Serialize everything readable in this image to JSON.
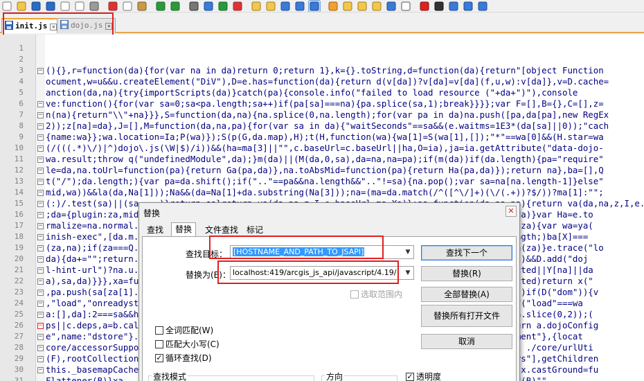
{
  "tabs": [
    {
      "label": "init.js"
    },
    {
      "label": "dojo.js"
    }
  ],
  "line_numbers": [
    "1",
    "2",
    "3",
    "4",
    "5",
    "6",
    "7",
    "8",
    "9",
    "10",
    "11",
    "12",
    "13",
    "14",
    "15",
    "16",
    "17",
    "18",
    "19",
    "20",
    "21",
    "22",
    "23",
    "24",
    "25",
    "26",
    "27",
    "28",
    "29",
    "30",
    "31"
  ],
  "code_lines": [
    "",
    "",
    "(){},r=function(da){for(var na in da)return 0;return 1},k={}.toString,d=function(da){return\"[object Function",
    "ocument,w=u&&u.createElement(\"DiV\"),D=e.has=function(da){return d(v[da])?v[da]=v[da](f,u,w):v[da]},v=D.cache=",
    "anction(da,na){try{importScripts(da)}catch(pa){console.info(\"failed to load resource (\"+da+\")\"),console",
    "ve:function(){for(var sa=0;sa<pa.length;sa++)if(pa[sa]===na){pa.splice(sa,1);break}}}};var F=[],B={},C=[],z=",
    "n(na){return\"\\\\\"+na}}},S=function(da,na){na.splice(0,na.length);for(var pa in da)na.push([pa,da[pa],new RegEx",
    "2));z[na]=da},J=[],M=function(da,na,pa){for(var sa in da){\"waitSeconds\"==sa&&(e.waitms=1E3*(da[sa]||0));\"cach",
    "{name:wa}};wa.location=Ia;P(wa)});S(p(G,da.map),H);t(H,function(wa){wa[1]=S(wa[1],[]);\"*\"==wa[0]&&(H.star=wa",
    "(/(((.*)\\/)|^)dojo\\.js(\\W|$)/i))&&(ha=ma[3]||\"\",c.baseUrl=c.baseUrl||ha,O=ia),ja=ia.getAttribute(\"data-dojo-",
    "wa.result;throw q(\"undefinedModule\",da);}m(da)||(M(da,0,sa),da=na,na=pa);if(m(da))if(da.length){pa=\"require\"",
    "le=da,na.toUrl=function(pa){return Ga(pa,da)},na.toAbsMid=function(pa){return Ha(pa,da)});return na},ba=[],Q",
    "t(\"/\");da.length;){var pa=da.shift();if(\"..\"==pa&&na.length&&\"..\"!=sa){na.pop();var sa=na[na.length-1]}else\"",
    "mid,wa))&&la(da,Na[1]));Na&&(da=Na[1]+da.substring(Na[3]));na=(ma=da.match(/^([^\\/]+)(\\/(.+))?$/))?ma[1]:\"\";",
    "(:)/.test(sa)||(sa=...)}return sa}return ya(da,na,z,I,e.baseUrl,ma,Xa)};pa=function(da,na,pa){return va(da,na,z,I,e.baseU",
    ";da={plugin:za,mid:...                                                             da.mid]=da)}var Ha=e.to",
    "rmalize=na.normal...                                                                unction(za){var wa=ya(",
    "inish-exec\",[da.m...                                                               ;X<ba.length;)ba[X]===",
    "(za,na);if(za===Q...                                                                 wa.push(za)}e.trace(\"lo",
    "da){da+=\"\";return...                                                              -hint-url\")&&D.add(\"doj",
    "l-hint-url\")?na.u...                                                               |da.injected||Y[na]||da",
    "a),sa,da)}}},xa=fu...                                                               da.injected)return x(\"",
    ",pa.push(sa[za[1]...                                                                D(\"dom\"))if(D(\"dom\")){v",
    ",\"load\",\"onreadysta...                                                            Element;if(\"load\"===wa",
    "a:[],da]:2===sa&&h...                                                               fine\",wa.slice(0,2));(",
    "ps||c.deps,a=b.cal...                                                               (a){return a.dojoConfig",
    "e\",name:\"dstore\"}...                                                              ,name:\"moment\"},{locat",
    "core/accessorSuppo...                                                               subclass ./core/urlUti",
    "(F),rootCollection...                                                               nceLayers\"],getChildren",
    "this._basemapCache...                                                               Cache)};x.castGround=fu",
    "Flattener(B)}xa ...                                                                 ...Child(B)\"\"..."
  ],
  "dialog": {
    "title": "替换",
    "close_label": "✕",
    "tabs": [
      "查找",
      "替换",
      "文件查找",
      "标记"
    ],
    "find_label": "查找目标：",
    "find_value": "[HOSTNAME_AND_PATH_TO_JSAPI]",
    "replace_label": "替换为(E)：",
    "replace_value": "localhost:419/arcgis_js_api/javascript/4.19/",
    "buttons": {
      "find_next": "查找下一个",
      "replace": "替换(R)",
      "replace_all": "全部替换(A)",
      "replace_all_open": "替换所有打开文件",
      "cancel": "取消"
    },
    "in_selection": "选取范围内",
    "match_whole_word": "全词匹配(W)",
    "match_case": "匹配大小写(C)",
    "wrap_around": "循环查找(D)",
    "search_mode": "查找模式",
    "direction": "方向",
    "transparency": "透明度"
  }
}
